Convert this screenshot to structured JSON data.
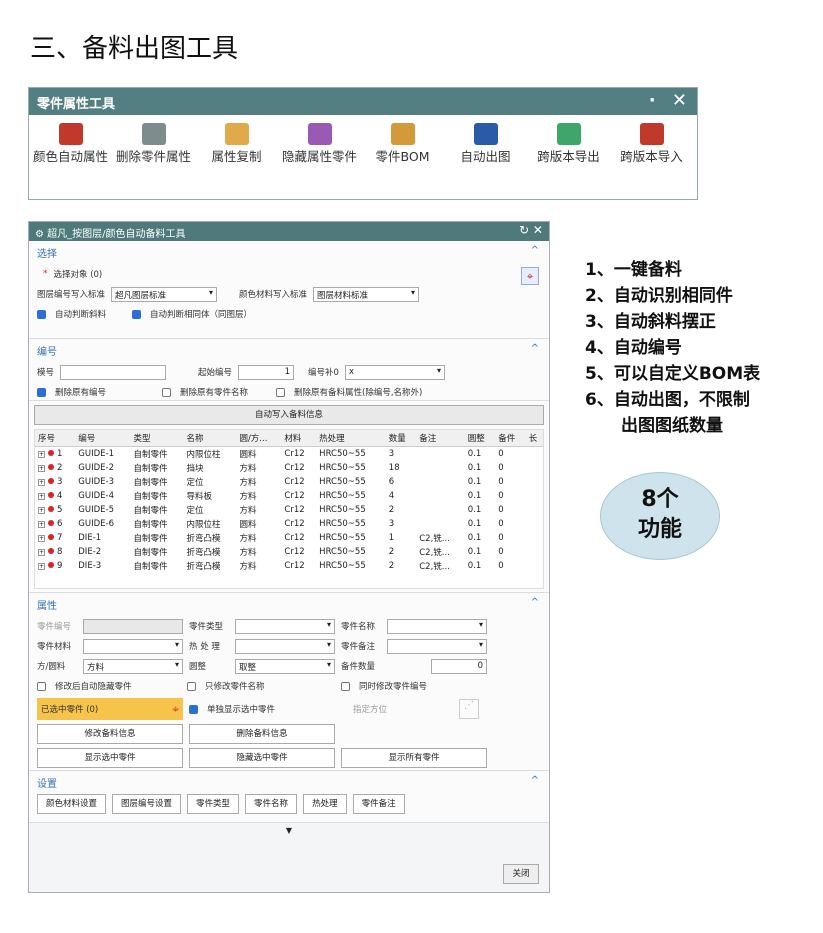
{
  "page_title": "三、备料出图工具",
  "toolbar": {
    "title": "零件属性工具",
    "minimize": "·",
    "close": "✕",
    "tools": [
      {
        "label": "颜色自动属性",
        "color": "#c0392b"
      },
      {
        "label": "删除零件属性",
        "color": "#7f8c8d"
      },
      {
        "label": "属性复制",
        "color": "#e0a94a"
      },
      {
        "label": "隐藏属性零件",
        "color": "#9b59b6"
      },
      {
        "label": "零件BOM",
        "color": "#d49a3a"
      },
      {
        "label": "自动出图",
        "color": "#2b5ba8"
      },
      {
        "label": "跨版本导出",
        "color": "#3fa66b"
      },
      {
        "label": "跨版本导入",
        "color": "#c0392b"
      }
    ]
  },
  "dialog": {
    "title": "超凡_按图层/颜色自动备料工具",
    "select": {
      "header": "选择",
      "object_label": "选择对象 (0)",
      "layer_label": "图层编号写入标准",
      "layer_value": "超凡图层标准",
      "color_label": "颜色材料写入标准",
      "color_value": "图层材料标准",
      "auto_slope": "自动判断斜料",
      "auto_same": "自动判断相同体（同图层）"
    },
    "numbering": {
      "header": "编号",
      "prefix_label": "模号",
      "start_label": "起始编号",
      "start_value": "1",
      "pad_label": "编号补0",
      "pad_value": "x",
      "del_num": "删除原有编号",
      "del_name": "删除原有零件名称",
      "del_attr": "删除原有备料属性(除编号,名称外)"
    },
    "write_button": "自动写入备料信息",
    "table": {
      "columns": [
        "序号",
        "编号",
        "类型",
        "名称",
        "圆/方...",
        "材料",
        "热处理",
        "数量",
        "备注",
        "圆整",
        "备件",
        "长"
      ],
      "rows": [
        [
          "1",
          "GUIDE-1",
          "自制零件",
          "内限位柱",
          "圆料",
          "Cr12",
          "HRC50~55",
          "3",
          "",
          "0.1",
          "0"
        ],
        [
          "2",
          "GUIDE-2",
          "自制零件",
          "挡块",
          "方料",
          "Cr12",
          "HRC50~55",
          "18",
          "",
          "0.1",
          "0"
        ],
        [
          "3",
          "GUIDE-3",
          "自制零件",
          "定位",
          "方料",
          "Cr12",
          "HRC50~55",
          "6",
          "",
          "0.1",
          "0"
        ],
        [
          "4",
          "GUIDE-4",
          "自制零件",
          "导料板",
          "方料",
          "Cr12",
          "HRC50~55",
          "4",
          "",
          "0.1",
          "0"
        ],
        [
          "5",
          "GUIDE-5",
          "自制零件",
          "定位",
          "方料",
          "Cr12",
          "HRC50~55",
          "2",
          "",
          "0.1",
          "0"
        ],
        [
          "6",
          "GUIDE-6",
          "自制零件",
          "内限位柱",
          "圆料",
          "Cr12",
          "HRC50~55",
          "3",
          "",
          "0.1",
          "0"
        ],
        [
          "7",
          "DIE-1",
          "自制零件",
          "折弯凸模",
          "方料",
          "Cr12",
          "HRC50~55",
          "1",
          "C2,铣...",
          "0.1",
          "0"
        ],
        [
          "8",
          "DIE-2",
          "自制零件",
          "折弯凸模",
          "方料",
          "Cr12",
          "HRC50~55",
          "2",
          "C2,铣...",
          "0.1",
          "0"
        ],
        [
          "9",
          "DIE-3",
          "自制零件",
          "折弯凸模",
          "方料",
          "Cr12",
          "HRC50~55",
          "2",
          "C2,铣...",
          "0.1",
          "0"
        ]
      ]
    },
    "props": {
      "header": "属性",
      "part_no": "零件编号",
      "part_type": "零件类型",
      "part_name": "零件名称",
      "part_mat": "零件材料",
      "heat": "热 处 理",
      "remark": "零件备注",
      "shape_label": "方/圆料",
      "shape_value": "方料",
      "round_label": "圆整",
      "round_value": "取整",
      "spare_label": "备件数量",
      "spare_value": "0",
      "hide_after": "修改后自动隐藏零件",
      "only_name": "只修改零件名称",
      "also_num": "同时修改零件编号",
      "selected": "已选中零件 (0)",
      "show_single": "单独显示选中零件",
      "orient": "指定方位",
      "btn_modify": "修改备料信息",
      "btn_delete": "删除备料信息",
      "btn_show_sel": "显示选中零件",
      "btn_hide_sel": "隐藏选中零件",
      "btn_show_all": "显示所有零件"
    },
    "settings": {
      "header": "设置",
      "buttons": [
        "颜色材料设置",
        "图层编号设置",
        "零件类型",
        "零件名称",
        "热处理",
        "零件备注"
      ]
    },
    "close": "关闭"
  },
  "features": [
    "1、一键备料",
    "2、自动识别相同件",
    "3、自动斜料摆正",
    "4、自动编号",
    "5、可以自定义BOM表",
    "6、自动出图，不限制",
    "出图图纸数量"
  ],
  "bubble": {
    "line1": "8个",
    "line2": "功能"
  }
}
